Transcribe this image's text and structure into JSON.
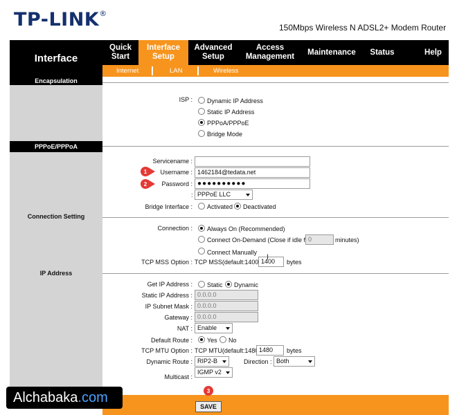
{
  "brand": {
    "logo": "TP-LINK",
    "trademark": "®",
    "model": "150Mbps Wireless N ADSL2+ Modem Router"
  },
  "sidebar": {
    "title": "Interface"
  },
  "nav": {
    "items": [
      {
        "label": "Quick\nStart",
        "active": false
      },
      {
        "label": "Interface\nSetup",
        "active": true
      },
      {
        "label": "Advanced\nSetup",
        "active": false
      },
      {
        "label": "Access\nManagement",
        "active": false
      },
      {
        "label": "Maintenance",
        "active": false
      },
      {
        "label": "Status",
        "active": false
      },
      {
        "label": "Help",
        "active": false
      }
    ],
    "subitems": [
      "Internet",
      "LAN",
      "Wireless"
    ]
  },
  "sections": {
    "encapsulation": "Encapsulation",
    "pppoe": "PPPoE/PPPoA",
    "connection_setting": "Connection Setting",
    "ip_address": "IP Address"
  },
  "isp": {
    "label": "ISP :",
    "options": [
      "Dynamic IP Address",
      "Static IP Address",
      "PPPoA/PPPoE",
      "Bridge Mode"
    ],
    "selected": "PPPoA/PPPoE"
  },
  "pppoe": {
    "servicename_label": "Servicename :",
    "servicename_value": "",
    "username_label": "Username :",
    "username_value": "1462184@tedata.net",
    "password_label": "Password :",
    "password_value": "●●●●●●●●●●",
    "encap_colon": ":",
    "encap_value": "PPPoE LLC",
    "bridge_label": "Bridge Interface :",
    "bridge_options": [
      "Activated",
      "Deactivated"
    ],
    "bridge_selected": "Deactivated"
  },
  "connection": {
    "label": "Connection :",
    "always_on": "Always On (Recommended)",
    "on_demand": "Connect On-Demand (Close if idle for",
    "idle_value": "0",
    "minutes": "minutes)",
    "manually": "Connect Manually",
    "selected": "Always On (Recommended)",
    "mss_label": "TCP MSS Option :",
    "mss_text": "TCP MSS(default:1400)",
    "mss_value": "1400",
    "mss_unit": "bytes"
  },
  "ip": {
    "get_ip_label": "Get IP Address :",
    "get_ip_options": [
      "Static",
      "Dynamic"
    ],
    "get_ip_selected": "Dynamic",
    "static_ip_label": "Static IP Address :",
    "static_ip_value": "0.0.0.0",
    "subnet_label": "IP Subnet Mask :",
    "subnet_value": "0.0.0.0",
    "gateway_label": "Gateway :",
    "gateway_value": "0.0.0.0",
    "nat_label": "NAT :",
    "nat_value": "Enable",
    "default_route_label": "Default Route :",
    "default_route_options": [
      "Yes",
      "No"
    ],
    "default_route_selected": "Yes",
    "mtu_label": "TCP MTU Option :",
    "mtu_text": "TCP MTU(default:1480)",
    "mtu_value": "1480",
    "mtu_unit": "bytes",
    "dyn_route_label": "Dynamic Route :",
    "dyn_route_value": "RIP2-B",
    "direction_label": "Direction :",
    "direction_value": "Both",
    "multicast_label": "Multicast :",
    "multicast_value": "IGMP v2"
  },
  "actions": {
    "save": "SAVE"
  },
  "markers": [
    "1",
    "2",
    "3"
  ],
  "watermark": {
    "name": "Alchabaka",
    "suffix": ".com"
  },
  "colors": {
    "accent": "#f7941d",
    "brand": "#15306e",
    "marker": "#e53935"
  }
}
